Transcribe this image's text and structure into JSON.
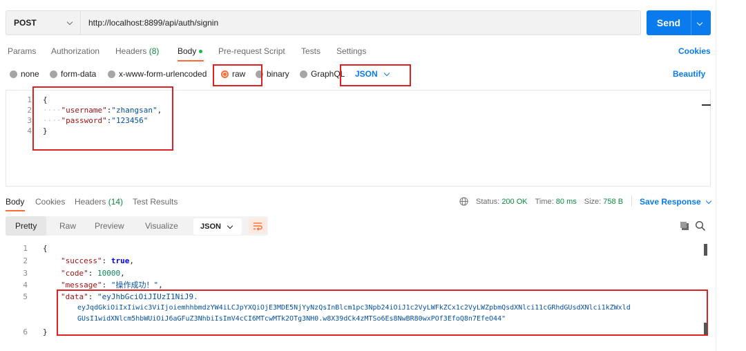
{
  "request": {
    "method": "POST",
    "url": "http://localhost:8899/api/auth/signin",
    "send_label": "Send"
  },
  "request_tabs": [
    {
      "label": "Params"
    },
    {
      "label": "Authorization"
    },
    {
      "label": "Headers",
      "count": "(8)"
    },
    {
      "label": "Body"
    },
    {
      "label": "Pre-request Script"
    },
    {
      "label": "Tests"
    },
    {
      "label": "Settings"
    }
  ],
  "cookies_label": "Cookies",
  "body_types": {
    "none": "none",
    "form_data": "form-data",
    "urlencoded": "x-www-form-urlencoded",
    "raw": "raw",
    "binary": "binary",
    "graphql": "GraphQL",
    "format": "JSON",
    "beautify": "Beautify",
    "selected": "raw"
  },
  "request_body": {
    "line_numbers": [
      "1",
      "2",
      "3",
      "4"
    ],
    "open_brace": "{",
    "close_brace": "}",
    "username_key": "\"username\"",
    "username_val": "\"zhangsan\"",
    "password_key": "\"password\"",
    "password_val": "\"123456\""
  },
  "response_tabs": [
    {
      "label": "Body"
    },
    {
      "label": "Cookies"
    },
    {
      "label": "Headers",
      "count": "(14)"
    },
    {
      "label": "Test Results"
    }
  ],
  "response_status": {
    "status_label": "Status:",
    "status_value": "200 OK",
    "time_label": "Time:",
    "time_value": "80 ms",
    "size_label": "Size:",
    "size_value": "758 B",
    "save_label": "Save Response"
  },
  "response_view": {
    "modes": [
      "Pretty",
      "Raw",
      "Preview",
      "Visualize"
    ],
    "format": "JSON"
  },
  "response_body": {
    "line_numbers": [
      "1",
      "2",
      "3",
      "4",
      "5",
      "6"
    ],
    "open_brace": "{",
    "close_brace": "}",
    "success_key": "\"success\"",
    "success_val": "true",
    "code_key": "\"code\"",
    "code_val": "10000",
    "message_key": "\"message\"",
    "message_val": "\"操作成功！\"",
    "data_key": "\"data\"",
    "data_line1": "\"eyJhbGciOiJIUzI1NiJ9.",
    "data_line2": "eyJqdGkiOiIxIiwic3ViIjoiemhhbmdzYW4iLCJpYXQiOjE3MDE5NjYyNzQsInBlcm1pc3Npb24iOiJ1c2VyLWFkZCx1c2VyLWZpbmQsdXNlci11cGRhdGUsdXNlci1kZWxld",
    "data_line3": "GUsI1widXNlcm5hbWUiOiJ6aGFuZ3NhbiIsImV4cCI6MTcwMTk2OTg3NH0.w8X39dCk4zMTSo6Es8NwBR80wxPOf3EfoQ8n7EfeO44\""
  },
  "colors": {
    "accent": "#ff6c37",
    "primary": "#097bed",
    "annotation": "#e02020",
    "status_ok": "#0a8a3e"
  }
}
